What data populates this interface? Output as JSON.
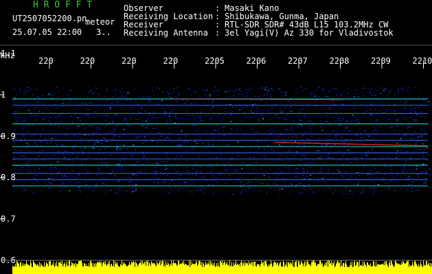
{
  "header": {
    "program": "H R O F F T",
    "filename": "UT2507052200.pn",
    "mode": "meteor",
    "date_time": "25.07.05 22:00",
    "page": "3.."
  },
  "info": [
    {
      "label": "Observer",
      "value": "Masaki Kano"
    },
    {
      "label": "Receiving Location",
      "value": "Shibukawa, Gunma, Japan"
    },
    {
      "label": "Receiver",
      "value": "RTL-SDR SDR# 43dB L15 103.2MHz CW"
    },
    {
      "label": "Receiving Antenna",
      "value": "3el Yagi(V) Az 330 for Vladivostok"
    }
  ],
  "chart_data": {
    "type": "heatmap",
    "ylabel": "kHz",
    "y_ticks": [
      "1.1",
      "1",
      "0.9",
      "0.8",
      "0.7",
      "0.6"
    ],
    "x_ticks": [
      "220",
      "220",
      "220",
      "220",
      "2205",
      "2206",
      "2207",
      "2208",
      "2209",
      "2210"
    ],
    "ylim": [
      0.6,
      1.12
    ],
    "bands_khz": [
      0.99,
      0.975,
      0.955,
      0.93,
      0.905,
      0.89,
      0.875,
      0.86,
      0.845,
      0.83,
      0.81,
      0.795,
      0.78
    ],
    "colors": {
      "bg": "#000000",
      "signal_low": "#0a1fd8",
      "signal_mid": "#22e0e0",
      "signal_high": "#ff3030",
      "power_bar": "#ffff00",
      "header_green": "#33cc33"
    }
  }
}
